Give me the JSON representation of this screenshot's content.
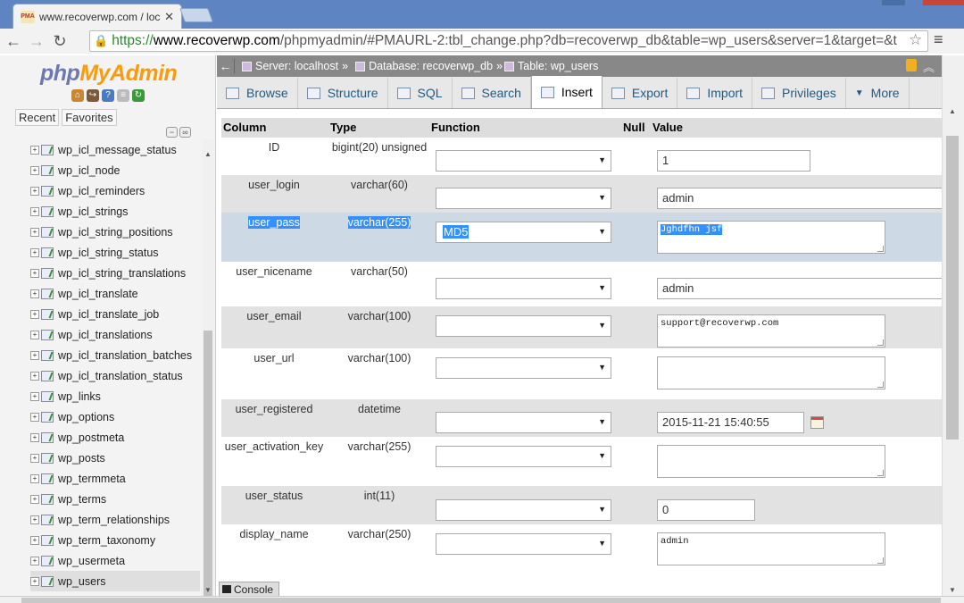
{
  "browser": {
    "tab_title": "www.recoverwp.com / loca",
    "favicon_text": "PMA",
    "url_https": "https://",
    "url_host": "www.recoverwp.com",
    "url_path": "/phpmyadmin/#PMAURL-2:tbl_change.php?db=recoverwp_db&table=wp_users&server=1&target=&t"
  },
  "sidebar": {
    "logo_php": "php",
    "logo_myadmin": "MyAdmin",
    "recent_label": "Recent",
    "favorites_label": "Favorites",
    "tables": [
      "wp_icl_message_status",
      "wp_icl_node",
      "wp_icl_reminders",
      "wp_icl_strings",
      "wp_icl_string_positions",
      "wp_icl_string_status",
      "wp_icl_string_translations",
      "wp_icl_translate",
      "wp_icl_translate_job",
      "wp_icl_translations",
      "wp_icl_translation_batches",
      "wp_icl_translation_status",
      "wp_links",
      "wp_options",
      "wp_postmeta",
      "wp_posts",
      "wp_termmeta",
      "wp_terms",
      "wp_term_relationships",
      "wp_term_taxonomy",
      "wp_usermeta",
      "wp_users"
    ],
    "active_table": "wp_users"
  },
  "breadcrumb": {
    "server": "Server: localhost",
    "database": "Database: recoverwp_db",
    "table": "Table: wp_users",
    "separator": "»"
  },
  "tabs": [
    "Browse",
    "Structure",
    "SQL",
    "Search",
    "Insert",
    "Export",
    "Import",
    "Privileges",
    "More"
  ],
  "active_tab": "Insert",
  "table_header": {
    "column": "Column",
    "type": "Type",
    "function": "Function",
    "null": "Null",
    "value": "Value"
  },
  "rows": [
    {
      "column": "ID",
      "type": "bigint(20) unsigned",
      "function": "",
      "value": "1"
    },
    {
      "column": "user_login",
      "type": "varchar(60)",
      "function": "",
      "value": "admin"
    },
    {
      "column": "user_pass",
      "type": "varchar(255)",
      "function": "MD5",
      "value": "Jghdfhn    jsf"
    },
    {
      "column": "user_nicename",
      "type": "varchar(50)",
      "function": "",
      "value": "admin"
    },
    {
      "column": "user_email",
      "type": "varchar(100)",
      "function": "",
      "value": "support@recoverwp.com"
    },
    {
      "column": "user_url",
      "type": "varchar(100)",
      "function": "",
      "value": ""
    },
    {
      "column": "user_registered",
      "type": "datetime",
      "function": "",
      "value": "2015-11-21 15:40:55"
    },
    {
      "column": "user_activation_key",
      "type": "varchar(255)",
      "function": "",
      "value": ""
    },
    {
      "column": "user_status",
      "type": "int(11)",
      "function": "",
      "value": "0"
    },
    {
      "column": "display_name",
      "type": "varchar(250)",
      "function": "",
      "value": "admin"
    }
  ],
  "console_label": "Console",
  "colors": {
    "chrome_frame": "#5e85c1",
    "pma_blue": "#6c78af",
    "pma_orange": "#f89c0e",
    "tab_link": "#235a81",
    "selection": "#3390ff",
    "marked_row": "#ced9e6"
  }
}
